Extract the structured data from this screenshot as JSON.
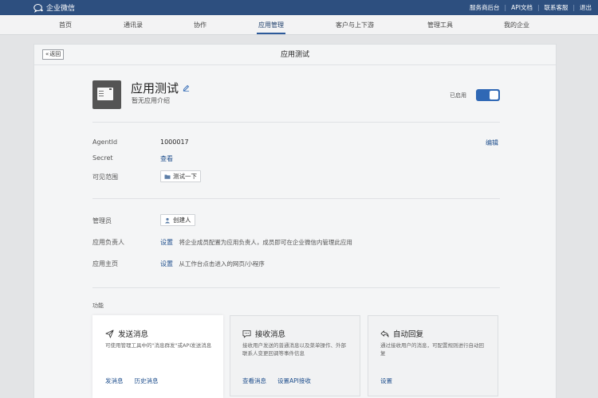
{
  "topbar": {
    "brand": "企业微信",
    "links": [
      "服务商后台",
      "API文档",
      "联系客服",
      "退出"
    ]
  },
  "nav": {
    "items": [
      "首页",
      "通讯录",
      "协作",
      "应用管理",
      "客户与上下游",
      "管理工具",
      "我的企业"
    ],
    "active_index": 3
  },
  "panel": {
    "back_label": "返回",
    "title": "应用测试"
  },
  "app": {
    "name": "应用测试",
    "description": "暂无应用介绍",
    "status_label": "已启用",
    "enabled": true
  },
  "details": {
    "agentid_label": "AgentId",
    "agentid_value": "1000017",
    "edit_label": "编辑",
    "secret_label": "Secret",
    "secret_link": "查看",
    "visible_label": "可见范围",
    "visible_value": "测试一下"
  },
  "admin": {
    "admin_label": "管理员",
    "admin_value": "创建人",
    "owner_label": "应用负责人",
    "owner_link": "设置",
    "owner_hint": "将企业成员配置为应用负责人，成员即可在企业微信内管理此应用",
    "homepage_label": "应用主页",
    "homepage_link": "设置",
    "homepage_hint": "从工作台点击进入的网页/小程序"
  },
  "features": {
    "section_label": "功能",
    "cards": [
      {
        "title": "发送消息",
        "icon": "send-icon",
        "desc": "可使用管理工具中的\"消息群发\"或API发送消息",
        "actions": [
          "发消息",
          "历史消息"
        ]
      },
      {
        "title": "接收消息",
        "icon": "chat-icon",
        "desc": "接收用户发送的普通消息以及菜单操作、外部联系人变更回调等事件信息",
        "actions": [
          "查看消息",
          "设置API接收"
        ]
      },
      {
        "title": "自动回复",
        "icon": "reply-icon",
        "desc": "通过接收用户的消息，可配置规则进行自动回复",
        "actions": [
          "设置"
        ]
      }
    ]
  },
  "colors": {
    "topbar": "#2d4f7f",
    "accent": "#2f68b5",
    "link": "#1f4f8d"
  }
}
